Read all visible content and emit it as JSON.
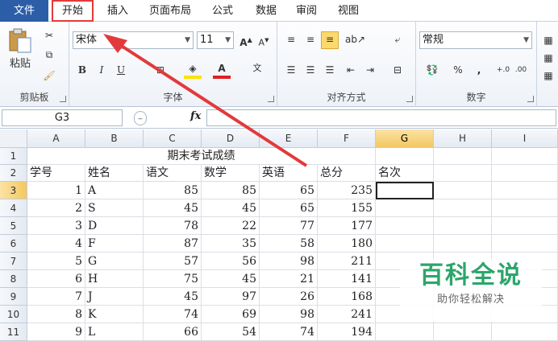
{
  "menu": {
    "tabs": [
      "文件",
      "开始",
      "插入",
      "页面布局",
      "公式",
      "数据",
      "审阅",
      "视图"
    ]
  },
  "ribbon": {
    "clipboard": {
      "label": "剪贴板",
      "paste": "粘贴"
    },
    "font": {
      "label": "字体",
      "font_name": "宋体",
      "font_size": "11",
      "bold": "B",
      "italic": "I",
      "underline": "U"
    },
    "alignment": {
      "label": "对齐方式"
    },
    "number": {
      "label": "数字",
      "format": "常规",
      "percent": "%",
      "comma": ","
    }
  },
  "formula_bar": {
    "name_box": "G3",
    "fx_label": "fx",
    "content": ""
  },
  "sheet": {
    "columns": [
      "A",
      "B",
      "C",
      "D",
      "E",
      "F",
      "G",
      "H",
      "I"
    ],
    "rows": [
      "1",
      "2",
      "3",
      "4",
      "5",
      "6",
      "7",
      "8",
      "9",
      "10",
      "11"
    ],
    "title": "期末考试成绩",
    "headers": [
      "学号",
      "姓名",
      "语文",
      "数学",
      "英语",
      "总分",
      "名次"
    ],
    "data": [
      [
        "1",
        "A",
        "85",
        "85",
        "65",
        "235"
      ],
      [
        "2",
        "S",
        "45",
        "45",
        "65",
        "155"
      ],
      [
        "3",
        "D",
        "78",
        "22",
        "77",
        "177"
      ],
      [
        "4",
        "F",
        "87",
        "35",
        "58",
        "180"
      ],
      [
        "5",
        "G",
        "57",
        "56",
        "98",
        "211"
      ],
      [
        "6",
        "H",
        "75",
        "45",
        "21",
        "141"
      ],
      [
        "7",
        "J",
        "45",
        "97",
        "26",
        "168"
      ],
      [
        "8",
        "K",
        "74",
        "69",
        "98",
        "241"
      ],
      [
        "9",
        "L",
        "66",
        "54",
        "74",
        "194"
      ]
    ],
    "selected_cell": "G3"
  },
  "watermark": {
    "title": "百科全说",
    "subtitle": "助你轻松解决"
  },
  "colors": {
    "file_tab": "#2c5ea8",
    "highlight": "#e23a3a",
    "brand_green": "#2ba66b",
    "selection_header": "#f3c761"
  }
}
